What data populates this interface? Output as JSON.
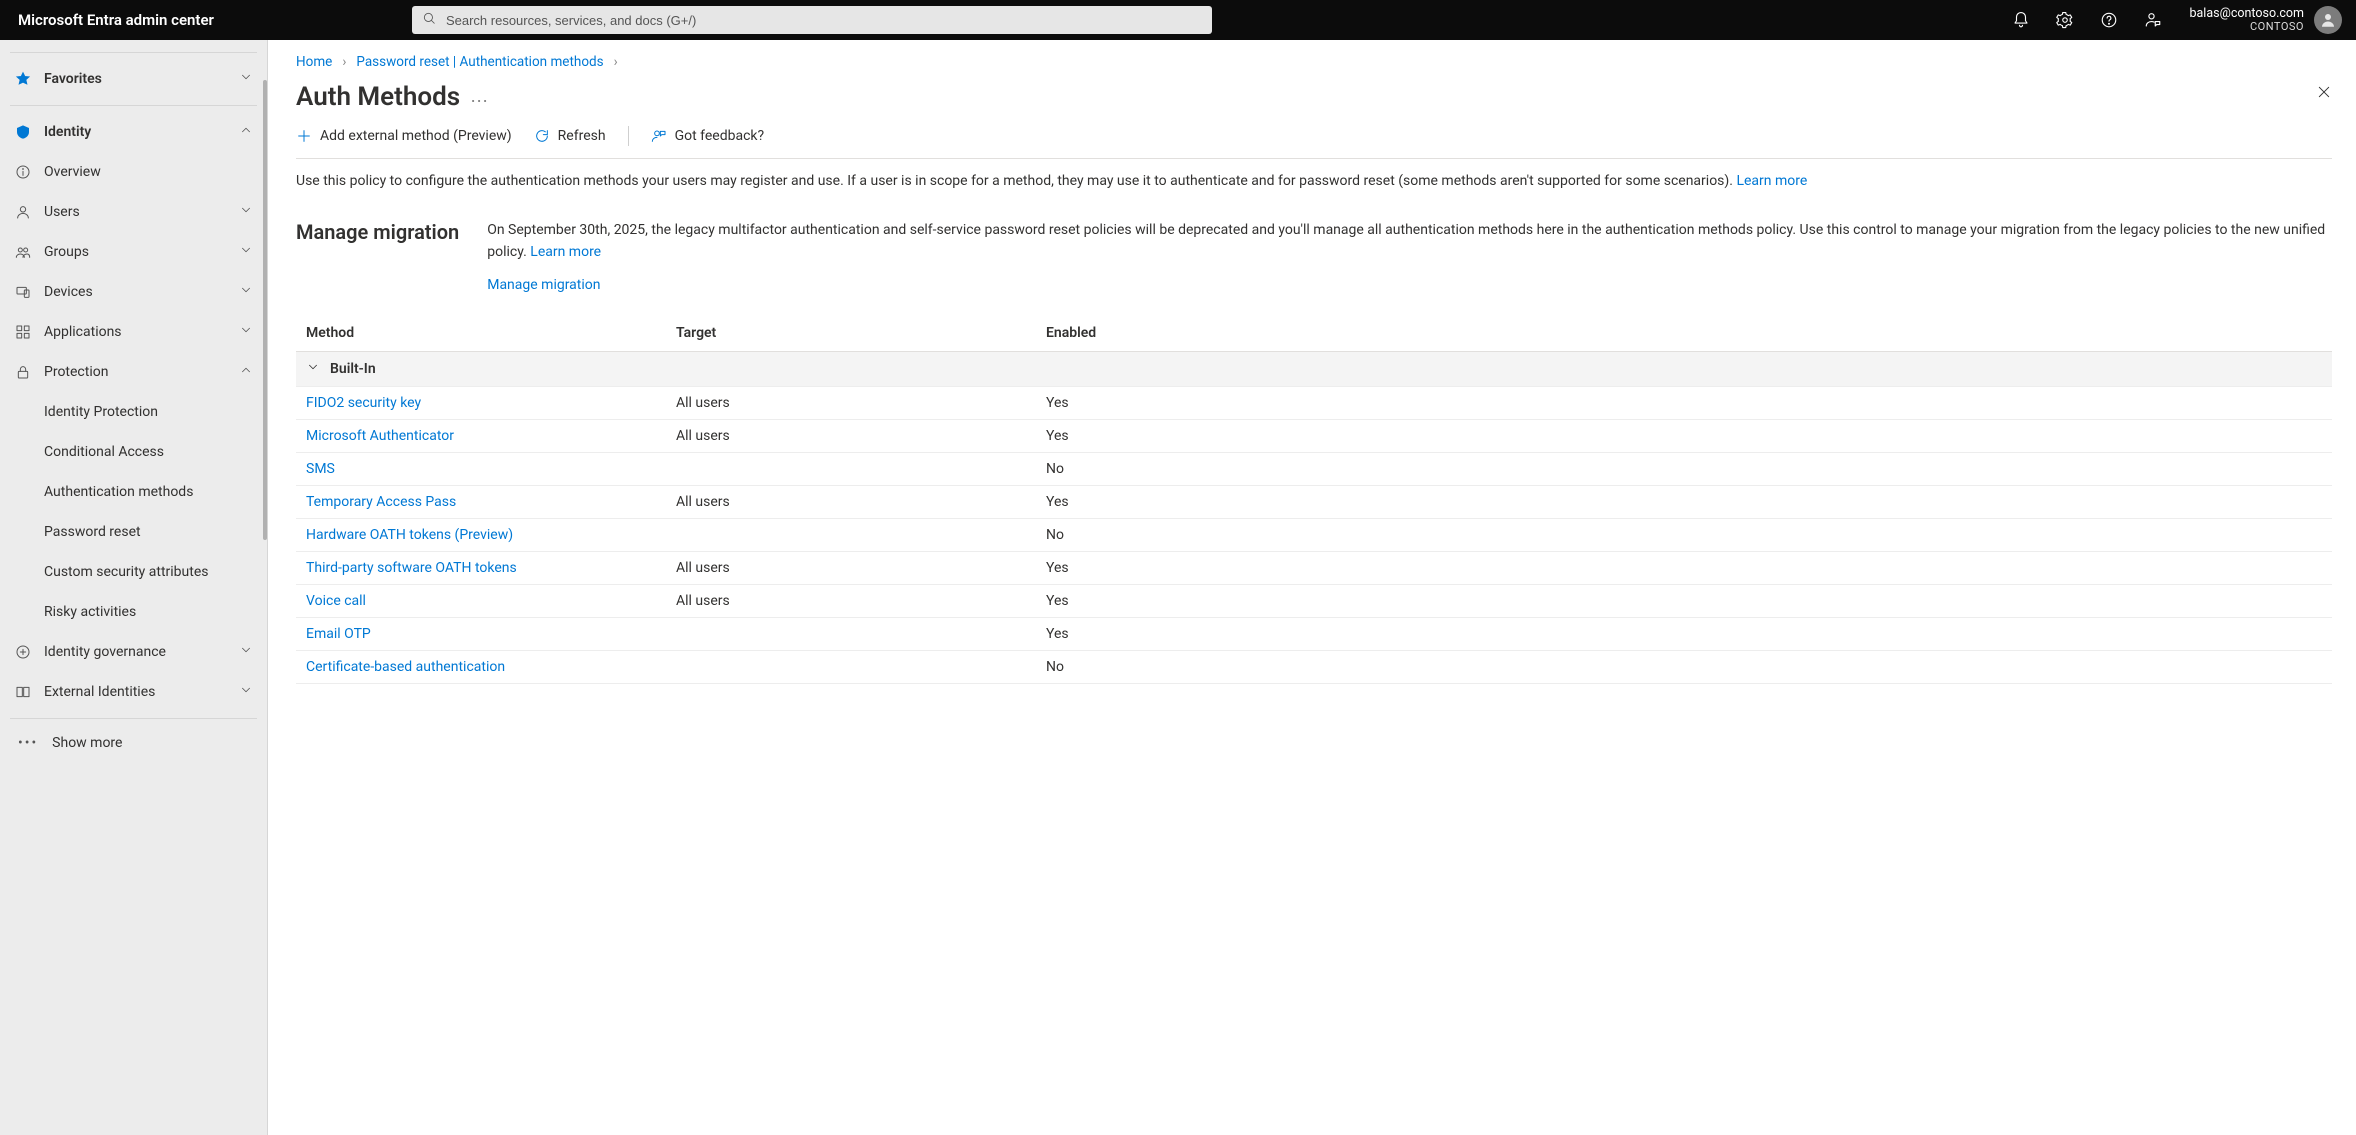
{
  "header": {
    "brand": "Microsoft Entra admin center",
    "search_placeholder": "Search resources, services, and docs (G+/)",
    "account_email": "balas@contoso.com",
    "account_org": "CONTOSO"
  },
  "sidebar": {
    "favorites": "Favorites",
    "identity": "Identity",
    "items": [
      {
        "label": "Overview"
      },
      {
        "label": "Users"
      },
      {
        "label": "Groups"
      },
      {
        "label": "Devices"
      },
      {
        "label": "Applications"
      },
      {
        "label": "Protection"
      }
    ],
    "protection_children": [
      {
        "label": "Identity Protection"
      },
      {
        "label": "Conditional Access"
      },
      {
        "label": "Authentication methods"
      },
      {
        "label": "Password reset"
      },
      {
        "label": "Custom security attributes"
      },
      {
        "label": "Risky activities"
      }
    ],
    "tail": [
      {
        "label": "Identity governance"
      },
      {
        "label": "External Identities"
      }
    ],
    "show_more": "Show more"
  },
  "breadcrumbs": {
    "home": "Home",
    "mid": "Password reset | Authentication methods"
  },
  "page": {
    "title": "Auth Methods",
    "cmd_add": "Add external method (Preview)",
    "cmd_refresh": "Refresh",
    "cmd_feedback": "Got feedback?",
    "intro": "Use this policy to configure the authentication methods your users may register and use. If a user is in scope for a method, they may use it to authenticate and for password reset (some methods aren't supported for some scenarios).",
    "learn_more": "Learn more",
    "migration_heading": "Manage migration",
    "migration_text": "On September 30th, 2025, the legacy multifactor authentication and self-service password reset policies will be deprecated and you'll manage all authentication methods here in the authentication methods policy. Use this control to manage your migration from the legacy policies to the new unified policy.",
    "migration_link": "Manage migration"
  },
  "table": {
    "col_method": "Method",
    "col_target": "Target",
    "col_enabled": "Enabled",
    "group_label": "Built-In",
    "rows": [
      {
        "method": "FIDO2 security key",
        "target": "All users",
        "enabled": "Yes"
      },
      {
        "method": "Microsoft Authenticator",
        "target": "All users",
        "enabled": "Yes"
      },
      {
        "method": "SMS",
        "target": "",
        "enabled": "No"
      },
      {
        "method": "Temporary Access Pass",
        "target": "All users",
        "enabled": "Yes"
      },
      {
        "method": "Hardware OATH tokens (Preview)",
        "target": "",
        "enabled": "No"
      },
      {
        "method": "Third-party software OATH tokens",
        "target": "All users",
        "enabled": "Yes"
      },
      {
        "method": "Voice call",
        "target": "All users",
        "enabled": "Yes"
      },
      {
        "method": "Email OTP",
        "target": "",
        "enabled": "Yes"
      },
      {
        "method": "Certificate-based authentication",
        "target": "",
        "enabled": "No"
      }
    ]
  }
}
